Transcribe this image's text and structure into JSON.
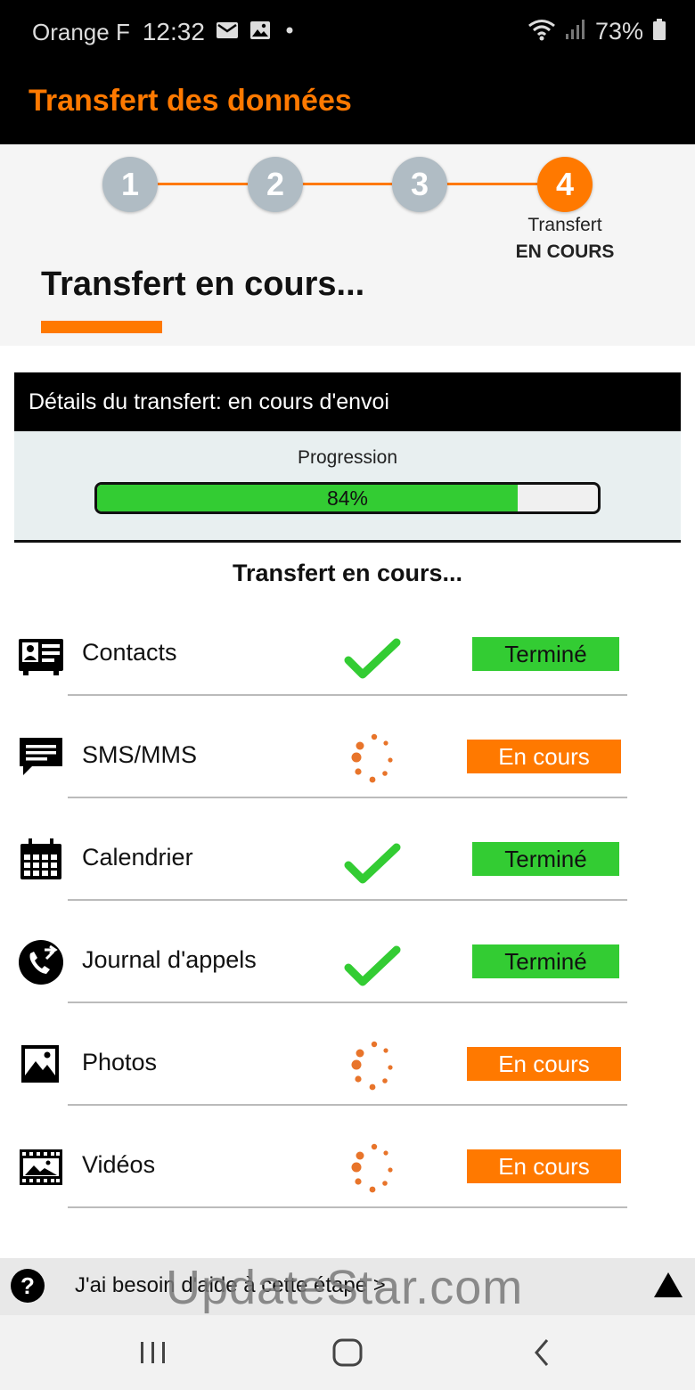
{
  "status_bar": {
    "carrier": "Orange F",
    "time": "12:32",
    "battery": "73%",
    "icons": [
      "mail-icon",
      "image-icon",
      "dot-icon",
      "wifi-icon",
      "signal-icon",
      "battery-icon"
    ]
  },
  "app_bar": {
    "title": "Transfert des données"
  },
  "stepper": {
    "steps": [
      "1",
      "2",
      "3",
      "4"
    ],
    "active_step": 4,
    "caption_line1": "Transfert",
    "caption_line2": "EN COURS"
  },
  "page_title": "Transfert en cours...",
  "details": {
    "header": "Détails du transfert: en cours d'envoi",
    "progress_label": "Progression",
    "progress_value": 84,
    "progress_text": "84%"
  },
  "list_title": "Transfert en cours...",
  "items": [
    {
      "label": "Contacts",
      "icon": "contact-card-icon",
      "status": "done",
      "badge": "Terminé"
    },
    {
      "label": "SMS/MMS",
      "icon": "message-icon",
      "status": "in_progress",
      "badge": "En cours"
    },
    {
      "label": "Calendrier",
      "icon": "calendar-icon",
      "status": "done",
      "badge": "Terminé"
    },
    {
      "label": "Journal d'appels",
      "icon": "call-log-icon",
      "status": "done",
      "badge": "Terminé"
    },
    {
      "label": "Photos",
      "icon": "photo-icon",
      "status": "in_progress",
      "badge": "En cours"
    },
    {
      "label": "Vidéos",
      "icon": "video-icon",
      "status": "in_progress",
      "badge": "En cours"
    }
  ],
  "help": {
    "text": "J'ai besoin d'aide à cette étape >"
  },
  "watermark": "UpdateStar.com",
  "colors": {
    "accent": "#ff7900",
    "done": "#33cc33",
    "inactive_step": "#b0bcc4"
  }
}
